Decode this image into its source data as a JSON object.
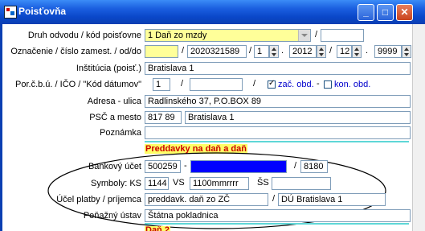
{
  "window": {
    "title": "Poisťovňa"
  },
  "form": {
    "druh_label": "Druh odvodu / kód poisťovne",
    "druh_value": "1 Daň zo mzdy",
    "oznacenie_label": "Označenie / číslo zamest. / od/do",
    "cislo_value": "2020321589",
    "day_from": "1",
    "year_from": "2012",
    "day_to": "12",
    "year_to": "9999",
    "institucia_label": "Inštitúcia (poisť.)",
    "institucia_value": "Bratislava 1",
    "porcbu_label": "Por.č.b.ú. / IČO / \"Kód dátumov\"",
    "porcbu_value": "1",
    "zac_obd": "zač. obd.",
    "kon_obd": "kon. obd.",
    "adresa_label": "Adresa - ulica",
    "adresa_value": "Radlinského 37, P.O.BOX 89",
    "psc_label": "PSČ a mesto",
    "psc_value": "817 89",
    "mesto_value": "Bratislava 1",
    "poznamka_label": "Poznámka",
    "preddavky_header": "Preddavky na daň a daň",
    "bank_label": "Bankový účet",
    "bank_account": "500259",
    "bank_code": "8180",
    "symboly_label": "Symboly: KS",
    "ks_value": "1144",
    "vs_label": "VS",
    "vs_value": "1100mmrrrr",
    "ss_label": "ŠS",
    "ucel_label": "Účel platby / príjemca",
    "ucel_value": "preddavk. daň zo ZČ",
    "prijemca_value": "DÚ Bratislava 1",
    "penazny_label": "Peňažný ústav",
    "penazny_value": "Štátna pokladnica",
    "next_header": "Daň 2"
  },
  "symbols": {
    "slash": "/",
    "dot": ".",
    "dash": "-"
  }
}
